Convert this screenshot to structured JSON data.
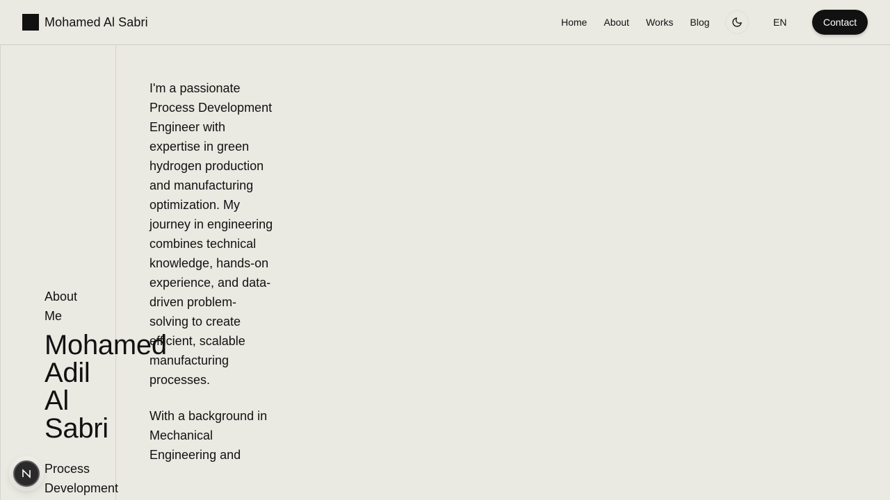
{
  "header": {
    "brand_name": "Mohamed Al Sabri",
    "nav": [
      "Home",
      "About",
      "Works",
      "Blog"
    ],
    "theme_icon": "moon-icon",
    "language": "EN",
    "contact_label": "Contact"
  },
  "about": {
    "section_label": "About Me",
    "name_lines": [
      "Mohamed",
      "Adil",
      "Al",
      "Sabri"
    ],
    "role": "Process Development"
  },
  "bio": {
    "paragraphs": [
      "I'm a passionate Process Development Engineer with expertise in green hydrogen production and manufacturing optimization. My journey in engineering combines technical knowledge, hands-on experience, and data-driven problem-solving to create efficient, scalable manufacturing processes.",
      "With a background in Mechanical Engineering and"
    ]
  },
  "badge": {
    "icon": "nextjs-icon"
  },
  "colors": {
    "background": "#eae9e2",
    "text": "#111111",
    "accent_button": "#111111",
    "rule": "#d6d4cc"
  }
}
